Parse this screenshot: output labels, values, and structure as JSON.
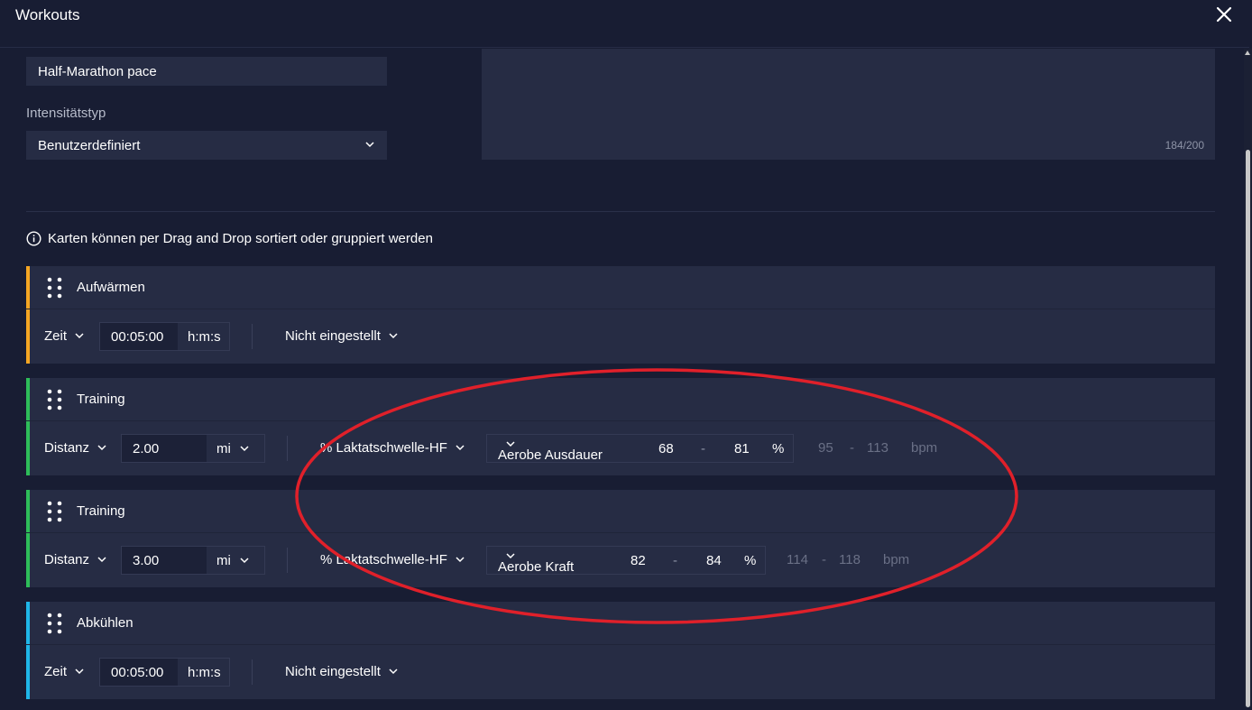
{
  "header": {
    "title": "Workouts"
  },
  "form": {
    "name_value": "Half-Marathon pace",
    "intensity_label": "Intensitätstyp",
    "intensity_value": "Benutzerdefiniert",
    "description_counter": "184/200"
  },
  "info_text": "Karten können per Drag and Drop sortiert oder gruppiert werden",
  "cards": [
    {
      "name": "Aufwärmen",
      "accent": "#f5a623",
      "duration_type": "Zeit",
      "value": "00:05:00",
      "unit": "h:m:s",
      "target": "Nicht eingestellt"
    },
    {
      "name": "Training",
      "accent": "#2ebd59",
      "duration_type": "Distanz",
      "value": "2.00",
      "unit": "mi",
      "target": "% Laktatschwelle-HF",
      "zone": "Aerobe Ausdauer",
      "low": "68",
      "dash": "-",
      "high": "81",
      "pct": "%",
      "bpm_low": "95",
      "bpm_high": "113",
      "bpm": "bpm"
    },
    {
      "name": "Training",
      "accent": "#2ebd59",
      "duration_type": "Distanz",
      "value": "3.00",
      "unit": "mi",
      "target": "% Laktatschwelle-HF",
      "zone": "Aerobe Kraft",
      "low": "82",
      "dash": "-",
      "high": "84",
      "pct": "%",
      "bpm_low": "114",
      "bpm_high": "118",
      "bpm": "bpm"
    },
    {
      "name": "Abkühlen",
      "accent": "#1fb6e8",
      "duration_type": "Zeit",
      "value": "00:05:00",
      "unit": "h:m:s",
      "target": "Nicht eingestellt"
    }
  ],
  "colors": {
    "background": "#181d33",
    "card": "#262c44",
    "annotation": "#e0202a"
  }
}
